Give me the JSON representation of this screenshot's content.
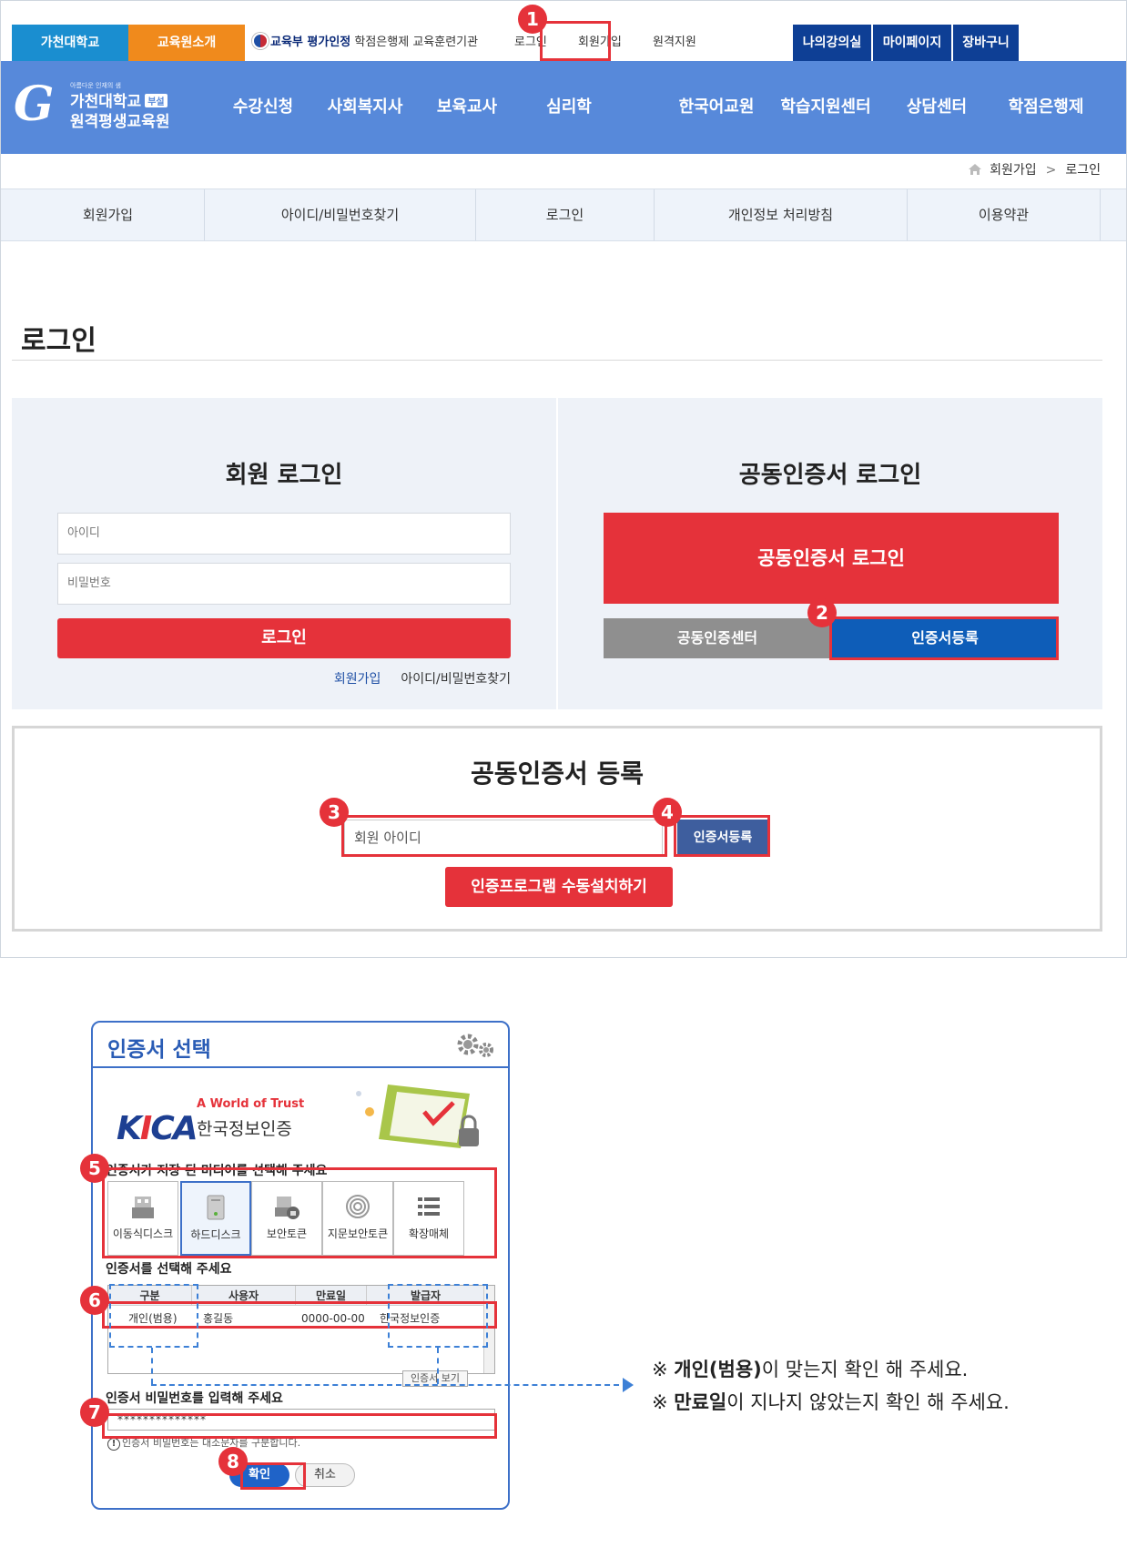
{
  "util": {
    "tab1": "가천대학교",
    "tab2": "교육원소개",
    "org_bold": "교육부 평가인정",
    "org_rest": " 학점은행제 교육훈련기관",
    "login": "로그인",
    "join": "회원가입",
    "remote": "원격지원",
    "my_class": "나의강의실",
    "my_page": "마이페이지",
    "cart": "장바구니"
  },
  "logo": {
    "sub": "아름다운 인재의 샘",
    "line1": "가천대학교",
    "badge": "부설",
    "line2": "원격평생교육원"
  },
  "gnb": [
    "수강신청",
    "사회복지사",
    "보육교사",
    "심리학",
    "한국어교원",
    "학습지원센터",
    "상담센터",
    "학점은행제"
  ],
  "breadcrumb": {
    "first": "회원가입",
    "sep": ">",
    "current": "로그인"
  },
  "subnav": [
    "회원가입",
    "아이디/비밀번호찾기",
    "로그인",
    "개인정보 처리방침",
    "이용약관"
  ],
  "page_title": "로그인",
  "member_login": {
    "title": "회원 로그인",
    "id_placeholder": "아이디",
    "pw_placeholder": "비밀번호",
    "login_button": "로그인",
    "join_link": "회원가입",
    "find_link": "아이디/비밀번호찾기"
  },
  "cert_login": {
    "title": "공동인증서 로그인",
    "login_button": "공동인증서 로그인",
    "center_button": "공동인증센터",
    "register_button": "인증서등록"
  },
  "cert_register": {
    "title": "공동인증서 등록",
    "id_placeholder": "회원 아이디",
    "register_button": "인증서등록",
    "manual_button": "인증프로그램 수동설치하기"
  },
  "markers": [
    "1",
    "2",
    "3",
    "4",
    "5",
    "6",
    "7",
    "8"
  ],
  "dialog": {
    "title": "인증서 선택",
    "brand_tag": "A World of Trust",
    "brand_name": "한국정보인증",
    "media_caption": "인증서가 저장 된 미디어를 선택해 주세요",
    "media": [
      "이동식디스크",
      "하드디스크",
      "보안토큰",
      "지문보안토큰",
      "확장매체"
    ],
    "cert_caption": "인증서를 선택해 주세요",
    "columns": [
      "구분",
      "사용자",
      "만료일",
      "발급자"
    ],
    "row": [
      "개인(범용)",
      "홍길동",
      "0000-00-00",
      "한국정보인증"
    ],
    "view_cert": "인증서 보기",
    "pw_caption": "인증서 비밀번호를 입력해 주세요",
    "pw_value": "**************",
    "pw_note": "인증서 비밀번호는 대소문자를 구분합니다.",
    "ok": "확인",
    "cancel": "취소"
  },
  "notes": {
    "line1_mark": "※ ",
    "line1_bold": "개인(범용)",
    "line1_rest": "이 맞는지 확인 해 주세요.",
    "line2_mark": "※ ",
    "line2_bold": "만료일",
    "line2_rest": "이 지나지 않았는지 확인 해 주세요."
  },
  "colors": {
    "accent_red": "#e5323a",
    "header_blue": "#5789da",
    "dark_blue": "#0e3f95"
  }
}
